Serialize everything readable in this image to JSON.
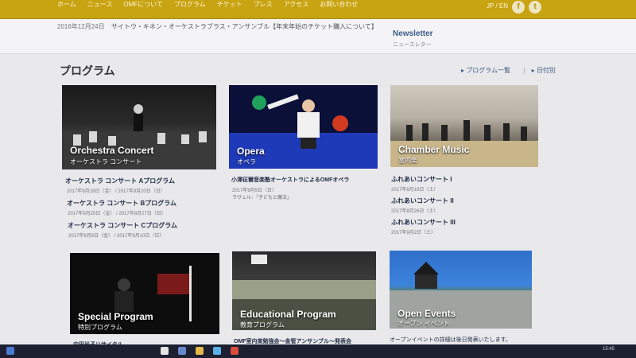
{
  "nav": {
    "items": [
      "ホーム",
      "ニュース",
      "OMFについて",
      "プログラム",
      "チケット",
      "プレス",
      "アクセス",
      "お問い合わせ"
    ],
    "lang": "JP / EN",
    "facebook_icon": "f",
    "twitter_icon": "t"
  },
  "news": {
    "date": "2016年12月24日",
    "text": "サイトウ・キネン・オーケストラブラス・アンサンブル【年末年始のチケット購入について】",
    "newsletter_title": "Newsletter",
    "newsletter_sub": "ニュースレター"
  },
  "section": {
    "title": "プログラム",
    "link_list": "プログラム一覧",
    "link_date": "日付別"
  },
  "cards": {
    "orchestra": {
      "title_en": "Orchestra Concert",
      "title_ja": "オーケストラ コンサート",
      "items": [
        {
          "title": "オーケストラ コンサート Aプログラム",
          "date": "2017年8月18日（金） / 2017年8月20日（日）"
        },
        {
          "title": "オーケストラ コンサート Bプログラム",
          "date": "2017年8月25日（金） / 2017年8月27日（日）"
        },
        {
          "title": "オーケストラ コンサート Cプログラム",
          "date": "2017年9月8日（金） / 2017年9月10日（日）"
        }
      ]
    },
    "opera": {
      "title_en": "Opera",
      "title_ja": "オペラ",
      "items": [
        {
          "title": "小澤征爾音楽塾オーケストラによるOMFオペラ",
          "date": "2017年9月5日（日）",
          "note": "ラヴェル：「子どもと魔法」"
        }
      ]
    },
    "chamber": {
      "title_en": "Chamber Music",
      "title_ja": "室内楽",
      "items": [
        {
          "title": "ふれあいコンサート I",
          "date": "2017年8月19日（土）"
        },
        {
          "title": "ふれあいコンサート II",
          "date": "2017年8月26日（土）"
        },
        {
          "title": "ふれあいコンサート III",
          "date": "2017年9月2日（土）"
        }
      ]
    },
    "special": {
      "title_en": "Special Program",
      "title_ja": "特別プログラム",
      "items": [
        {
          "title": "内田光子リサイタル"
        }
      ]
    },
    "educational": {
      "title_en": "Educational Program",
      "title_ja": "教育プログラム",
      "items": [
        {
          "title": "OMF室内楽勉強会〜金管アンサンブル〜発表会"
        }
      ]
    },
    "events": {
      "title_en": "Open Events",
      "title_ja": "オープン イベント",
      "items": [
        {
          "title": "オープンイベントの詳細は後日発表いたします。"
        }
      ]
    }
  },
  "taskbar": {
    "time": "15:45"
  }
}
